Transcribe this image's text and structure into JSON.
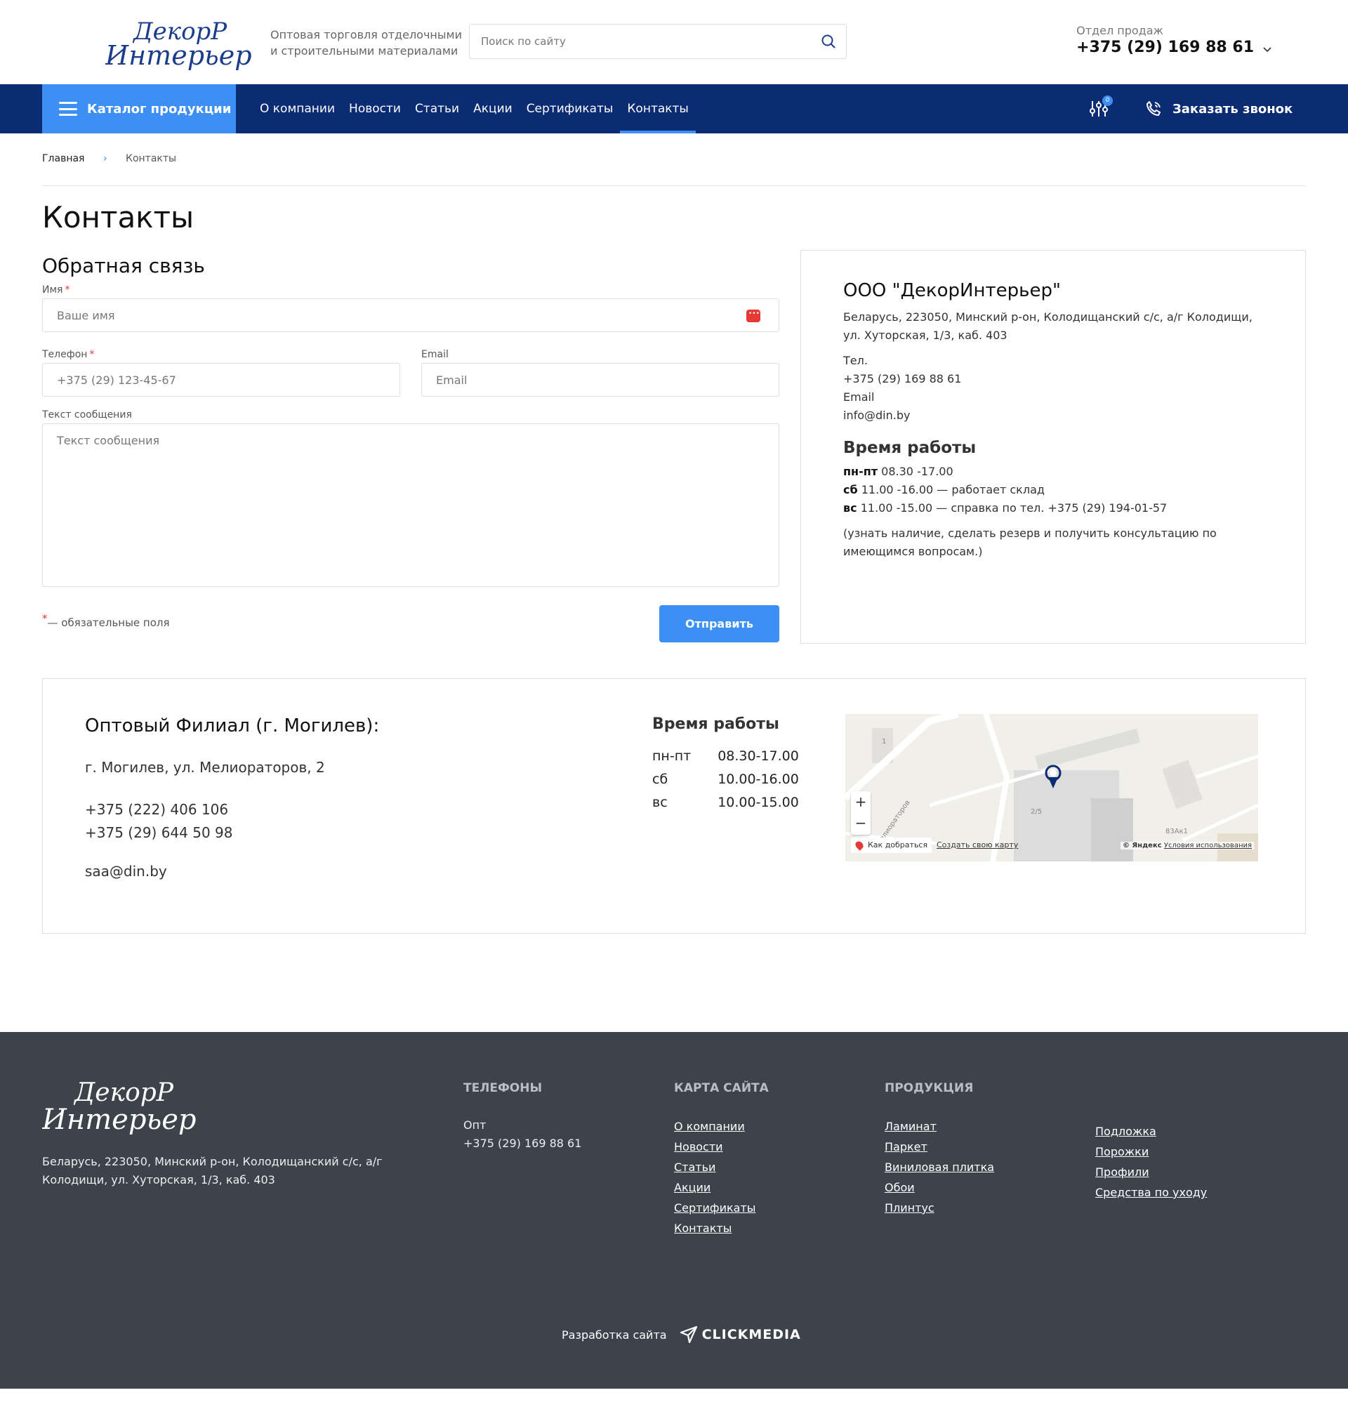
{
  "header": {
    "logo_text": "ДекорР Интерьер",
    "tagline_line1": "Оптовая торговля отделочными",
    "tagline_line2": "и строительными материалами",
    "search_placeholder": "Поиск по сайту",
    "sales_label": "Отдел продаж",
    "sales_phone": "+375 (29) 169 88 61"
  },
  "nav": {
    "catalog_label": "Каталог продукции",
    "items": [
      {
        "label": "О компании"
      },
      {
        "label": "Новости"
      },
      {
        "label": "Статьи"
      },
      {
        "label": "Акции"
      },
      {
        "label": "Сертификаты"
      },
      {
        "label": "Контакты"
      }
    ],
    "compare_count": "0",
    "callback_label": "Заказать звонок"
  },
  "breadcrumb": {
    "home": "Главная",
    "sep": "›",
    "current": "Контакты"
  },
  "page_title": "Контакты",
  "form": {
    "title": "Обратная связь",
    "name_label": "Имя",
    "name_placeholder": "Ваше имя",
    "phone_label": "Телефон",
    "phone_placeholder": "+375 (29) 123-45-67",
    "email_label": "Email",
    "email_placeholder": "Email",
    "message_label": "Текст сообщения",
    "message_placeholder": "Текст сообщения",
    "required_mark": "*",
    "required_note": "— обязательные поля",
    "submit_label": "Отправить"
  },
  "company": {
    "name": "ООО \"ДекорИнтерьер\"",
    "address": "Беларусь, 223050, Минский р-он, Колодищанский с/с, а/г Колодищи, ул. Хуторская, 1/3, каб. 403",
    "tel_label": "Тел.",
    "tel": "+375 (29) 169 88 61",
    "email_label": "Email",
    "email": "info@din.by",
    "hours_title": "Время работы",
    "schedule": [
      {
        "day": "пн-пт",
        "time": "08.30 -17.00"
      },
      {
        "day": "сб",
        "time": "11.00 -16.00 — работает склад"
      },
      {
        "day": "вс",
        "time": "11.00 -15.00 — справка по тел. +375 (29) 194-01-57"
      }
    ],
    "note": "(узнать наличие, сделать резерв и получить консультацию по имеющимся вопросам.)"
  },
  "branch": {
    "title": "Оптовый Филиал (г. Могилев):",
    "address": "г. Могилев, ул. Мелиораторов, 2",
    "phone1": "+375 (222) 406 106",
    "phone2": "+375 (29) 644 50 98",
    "email": "saa@din.by",
    "hours_title": "Время работы",
    "hours": [
      {
        "day": "пн-пт",
        "time": "08.30-17.00"
      },
      {
        "day": "сб",
        "time": "10.00-16.00"
      },
      {
        "day": "вс",
        "time": "10.00-15.00"
      }
    ],
    "map": {
      "route_label": "Как добраться",
      "create_label": "Создать свою карту",
      "copyright": "© Яндекс",
      "terms": "Условия использования",
      "label_1": "1",
      "label_25": "2/5",
      "label_83": "83Ак1",
      "street": "Мелиораторов"
    }
  },
  "footer": {
    "address": "Беларусь, 223050, Минский р-он, Колодищанский с/с, а/г Колодищи, ул. Хуторская, 1/3, каб. 403",
    "phones_title": "ТЕЛЕФОНЫ",
    "phones_label": "Опт",
    "phones_value": "+375 (29) 169 88 61",
    "sitemap_title": "КАРТА САЙТА",
    "sitemap": [
      "О компании",
      "Новости",
      "Статьи",
      "Акции",
      "Сертификаты",
      "Контакты"
    ],
    "products_title": "ПРОДУКЦИЯ",
    "products_col1": [
      "Ламинат",
      "Паркет",
      "Виниловая плитка",
      "Обои",
      "Плинтус"
    ],
    "products_col2": [
      "Подложка",
      "Порожки",
      "Профили",
      "Средства по уходу"
    ],
    "dev_label": "Разработка сайта",
    "dev_brand": "CLICKMEDIA"
  },
  "colors": {
    "nav_bg": "#0b2b72",
    "accent": "#3d8ff4",
    "footer_bg": "#3d434b",
    "required": "#e53935"
  }
}
